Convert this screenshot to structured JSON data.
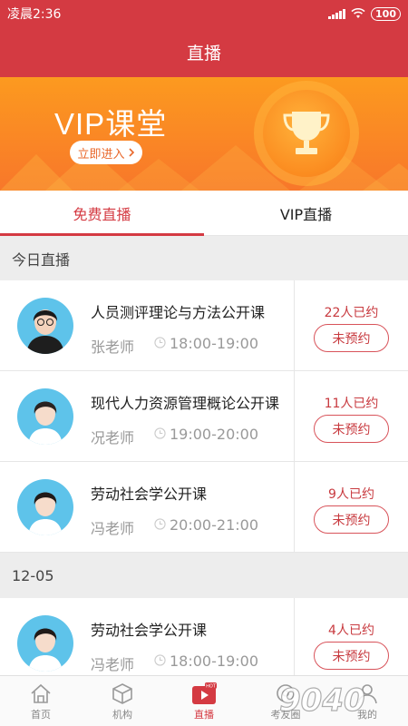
{
  "status_bar": {
    "time": "凌晨2:36",
    "battery": "100"
  },
  "header": {
    "title": "直播"
  },
  "banner": {
    "title": "VIP课堂",
    "button_label": "立即进入"
  },
  "tabs": [
    {
      "label": "免费直播",
      "active": true
    },
    {
      "label": "VIP直播",
      "active": false
    }
  ],
  "sections": [
    {
      "heading": "今日直播",
      "courses": [
        {
          "title": "人员测评理论与方法公开课",
          "teacher": "张老师",
          "time": "18:00-19:00",
          "count": "22人已约",
          "action": "未预约"
        },
        {
          "title": "现代人力资源管理概论公开课",
          "teacher": "况老师",
          "time": "19:00-20:00",
          "count": "11人已约",
          "action": "未预约"
        },
        {
          "title": "劳动社会学公开课",
          "teacher": "冯老师",
          "time": "20:00-21:00",
          "count": "9人已约",
          "action": "未预约"
        }
      ]
    },
    {
      "heading": "12-05",
      "courses": [
        {
          "title": "劳动社会学公开课",
          "teacher": "冯老师",
          "time": "18:00-19:00",
          "count": "4人已约",
          "action": "未预约"
        }
      ]
    }
  ],
  "bottom_nav": [
    {
      "label": "首页",
      "icon": "home-icon"
    },
    {
      "label": "机构",
      "icon": "cube-icon"
    },
    {
      "label": "直播",
      "icon": "live-video-icon",
      "active": true,
      "badge": "HOT"
    },
    {
      "label": "考友圈",
      "icon": "community-icon"
    },
    {
      "label": "我的",
      "icon": "profile-icon"
    }
  ],
  "watermark": "9040",
  "colors": {
    "brand_red": "#d43a42",
    "banner_orange": "#f8772a",
    "avatar_blue": "#5ec3ea"
  }
}
